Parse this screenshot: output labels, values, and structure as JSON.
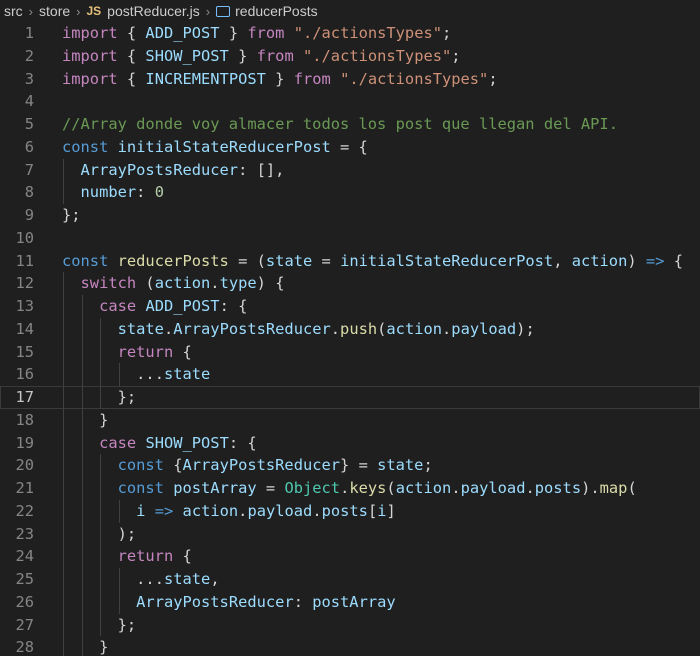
{
  "breadcrumb": {
    "items": [
      "src",
      "store",
      "postReducer.js",
      "reducerPosts"
    ],
    "file_badge": "JS"
  },
  "editor": {
    "current_line": 17,
    "lines": [
      {
        "n": 1,
        "indent": 0,
        "tokens": [
          [
            "kw-ctrl",
            "import"
          ],
          [
            "pun",
            " { "
          ],
          [
            "var",
            "ADD_POST"
          ],
          [
            "pun",
            " } "
          ],
          [
            "kw-ctrl",
            "from"
          ],
          [
            "pun",
            " "
          ],
          [
            "str",
            "\"./actionsTypes\""
          ],
          [
            "pun",
            ";"
          ]
        ]
      },
      {
        "n": 2,
        "indent": 0,
        "tokens": [
          [
            "kw-ctrl",
            "import"
          ],
          [
            "pun",
            " { "
          ],
          [
            "var",
            "SHOW_POST"
          ],
          [
            "pun",
            " } "
          ],
          [
            "kw-ctrl",
            "from"
          ],
          [
            "pun",
            " "
          ],
          [
            "str",
            "\"./actionsTypes\""
          ],
          [
            "pun",
            ";"
          ]
        ]
      },
      {
        "n": 3,
        "indent": 0,
        "tokens": [
          [
            "kw-ctrl",
            "import"
          ],
          [
            "pun",
            " { "
          ],
          [
            "var",
            "INCREMENTPOST"
          ],
          [
            "pun",
            " } "
          ],
          [
            "kw-ctrl",
            "from"
          ],
          [
            "pun",
            " "
          ],
          [
            "str",
            "\"./actionsTypes\""
          ],
          [
            "pun",
            ";"
          ]
        ]
      },
      {
        "n": 4,
        "indent": 0,
        "tokens": []
      },
      {
        "n": 5,
        "indent": 0,
        "tokens": [
          [
            "cmt",
            "//Array donde voy almacer todos los post que llegan del API."
          ]
        ]
      },
      {
        "n": 6,
        "indent": 0,
        "tokens": [
          [
            "kw-decl",
            "const"
          ],
          [
            "pun",
            " "
          ],
          [
            "var",
            "initialStateReducerPost"
          ],
          [
            "pun",
            " = {"
          ]
        ]
      },
      {
        "n": 7,
        "indent": 1,
        "tokens": [
          [
            "var",
            "ArrayPostsReducer"
          ],
          [
            "pun",
            ": [],"
          ]
        ]
      },
      {
        "n": 8,
        "indent": 1,
        "tokens": [
          [
            "var",
            "number"
          ],
          [
            "pun",
            ": "
          ],
          [
            "num",
            "0"
          ]
        ]
      },
      {
        "n": 9,
        "indent": 0,
        "tokens": [
          [
            "pun",
            "};"
          ]
        ]
      },
      {
        "n": 10,
        "indent": 0,
        "tokens": []
      },
      {
        "n": 11,
        "indent": 0,
        "tokens": [
          [
            "kw-decl",
            "const"
          ],
          [
            "pun",
            " "
          ],
          [
            "fn",
            "reducerPosts"
          ],
          [
            "pun",
            " = ("
          ],
          [
            "var",
            "state"
          ],
          [
            "pun",
            " = "
          ],
          [
            "var",
            "initialStateReducerPost"
          ],
          [
            "pun",
            ", "
          ],
          [
            "var",
            "action"
          ],
          [
            "pun",
            ") "
          ],
          [
            "kw-decl",
            "=>"
          ],
          [
            "pun",
            " {"
          ]
        ]
      },
      {
        "n": 12,
        "indent": 1,
        "tokens": [
          [
            "kw-ctrl",
            "switch"
          ],
          [
            "pun",
            " ("
          ],
          [
            "var",
            "action"
          ],
          [
            "pun",
            "."
          ],
          [
            "var",
            "type"
          ],
          [
            "pun",
            ") {"
          ]
        ]
      },
      {
        "n": 13,
        "indent": 2,
        "tokens": [
          [
            "kw-ctrl",
            "case"
          ],
          [
            "pun",
            " "
          ],
          [
            "var",
            "ADD_POST"
          ],
          [
            "pun",
            ": {"
          ]
        ]
      },
      {
        "n": 14,
        "indent": 3,
        "tokens": [
          [
            "var",
            "state"
          ],
          [
            "pun",
            "."
          ],
          [
            "var",
            "ArrayPostsReducer"
          ],
          [
            "pun",
            "."
          ],
          [
            "fn",
            "push"
          ],
          [
            "pun",
            "("
          ],
          [
            "var",
            "action"
          ],
          [
            "pun",
            "."
          ],
          [
            "var",
            "payload"
          ],
          [
            "pun",
            ");"
          ]
        ]
      },
      {
        "n": 15,
        "indent": 3,
        "tokens": [
          [
            "kw-ctrl",
            "return"
          ],
          [
            "pun",
            " {"
          ]
        ]
      },
      {
        "n": 16,
        "indent": 4,
        "tokens": [
          [
            "pun",
            "..."
          ],
          [
            "var",
            "state"
          ]
        ]
      },
      {
        "n": 17,
        "indent": 3,
        "tokens": [
          [
            "pun",
            "};"
          ]
        ]
      },
      {
        "n": 18,
        "indent": 2,
        "tokens": [
          [
            "pun",
            "}"
          ]
        ]
      },
      {
        "n": 19,
        "indent": 2,
        "tokens": [
          [
            "kw-ctrl",
            "case"
          ],
          [
            "pun",
            " "
          ],
          [
            "var",
            "SHOW_POST"
          ],
          [
            "pun",
            ": {"
          ]
        ]
      },
      {
        "n": 20,
        "indent": 3,
        "tokens": [
          [
            "kw-decl",
            "const"
          ],
          [
            "pun",
            " {"
          ],
          [
            "var",
            "ArrayPostsReducer"
          ],
          [
            "pun",
            "} = "
          ],
          [
            "var",
            "state"
          ],
          [
            "pun",
            ";"
          ]
        ]
      },
      {
        "n": 21,
        "indent": 3,
        "tokens": [
          [
            "kw-decl",
            "const"
          ],
          [
            "pun",
            " "
          ],
          [
            "var",
            "postArray"
          ],
          [
            "pun",
            " = "
          ],
          [
            "cls",
            "Object"
          ],
          [
            "pun",
            "."
          ],
          [
            "fn",
            "keys"
          ],
          [
            "pun",
            "("
          ],
          [
            "var",
            "action"
          ],
          [
            "pun",
            "."
          ],
          [
            "var",
            "payload"
          ],
          [
            "pun",
            "."
          ],
          [
            "var",
            "posts"
          ],
          [
            "pun",
            ")."
          ],
          [
            "fn",
            "map"
          ],
          [
            "pun",
            "("
          ]
        ]
      },
      {
        "n": 22,
        "indent": 4,
        "tokens": [
          [
            "var",
            "i"
          ],
          [
            "pun",
            " "
          ],
          [
            "kw-decl",
            "=>"
          ],
          [
            "pun",
            " "
          ],
          [
            "var",
            "action"
          ],
          [
            "pun",
            "."
          ],
          [
            "var",
            "payload"
          ],
          [
            "pun",
            "."
          ],
          [
            "var",
            "posts"
          ],
          [
            "pun",
            "["
          ],
          [
            "var",
            "i"
          ],
          [
            "pun",
            "]"
          ]
        ]
      },
      {
        "n": 23,
        "indent": 3,
        "tokens": [
          [
            "pun",
            ");"
          ]
        ]
      },
      {
        "n": 24,
        "indent": 3,
        "tokens": [
          [
            "kw-ctrl",
            "return"
          ],
          [
            "pun",
            " {"
          ]
        ]
      },
      {
        "n": 25,
        "indent": 4,
        "tokens": [
          [
            "pun",
            "..."
          ],
          [
            "var",
            "state"
          ],
          [
            "pun",
            ","
          ]
        ]
      },
      {
        "n": 26,
        "indent": 4,
        "tokens": [
          [
            "var",
            "ArrayPostsReducer"
          ],
          [
            "pun",
            ": "
          ],
          [
            "var",
            "postArray"
          ]
        ]
      },
      {
        "n": 27,
        "indent": 3,
        "tokens": [
          [
            "pun",
            "};"
          ]
        ]
      },
      {
        "n": 28,
        "indent": 2,
        "tokens": [
          [
            "pun",
            "}"
          ]
        ]
      }
    ]
  }
}
